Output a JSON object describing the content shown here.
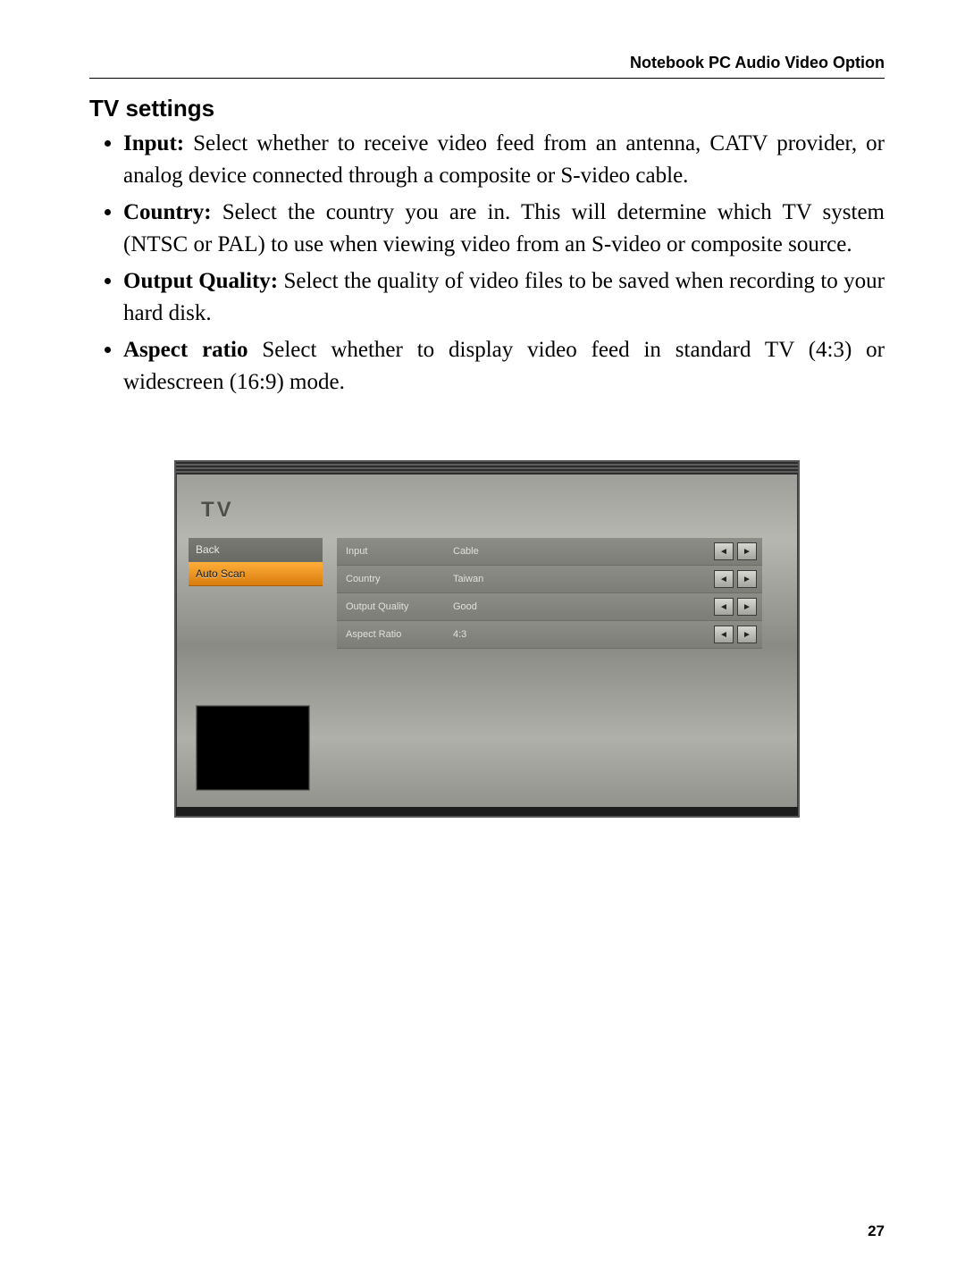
{
  "header": {
    "running_head": "Notebook PC Audio Video Option"
  },
  "section": {
    "title": "TV settings",
    "bullets": [
      {
        "lead": "Input:",
        "text": " Select whether to receive video feed from an antenna, CATV provider, or analog device connected through a composite or S-video cable."
      },
      {
        "lead": "Country:",
        "text": " Select the country you are in. This will determine which TV system (NTSC or PAL) to use when viewing video from an S-video or composite source."
      },
      {
        "lead": "Output Quality:",
        "text": " Select the quality of video files to be saved when recording to your hard disk."
      },
      {
        "lead": "Aspect ratio",
        "text": " Select whether to display video feed in standard TV (4:3) or widescreen (16:9) mode."
      }
    ]
  },
  "screenshot": {
    "title": "TV",
    "sidebar": [
      {
        "label": "Back",
        "selected": false
      },
      {
        "label": "Auto Scan",
        "selected": true
      }
    ],
    "rows": [
      {
        "label": "Input",
        "value": "Cable"
      },
      {
        "label": "Country",
        "value": "Taiwan"
      },
      {
        "label": "Output Quality",
        "value": "Good"
      },
      {
        "label": "Aspect Ratio",
        "value": "4:3"
      }
    ],
    "arrow_left": "◄",
    "arrow_right": "►"
  },
  "page_number": "27"
}
